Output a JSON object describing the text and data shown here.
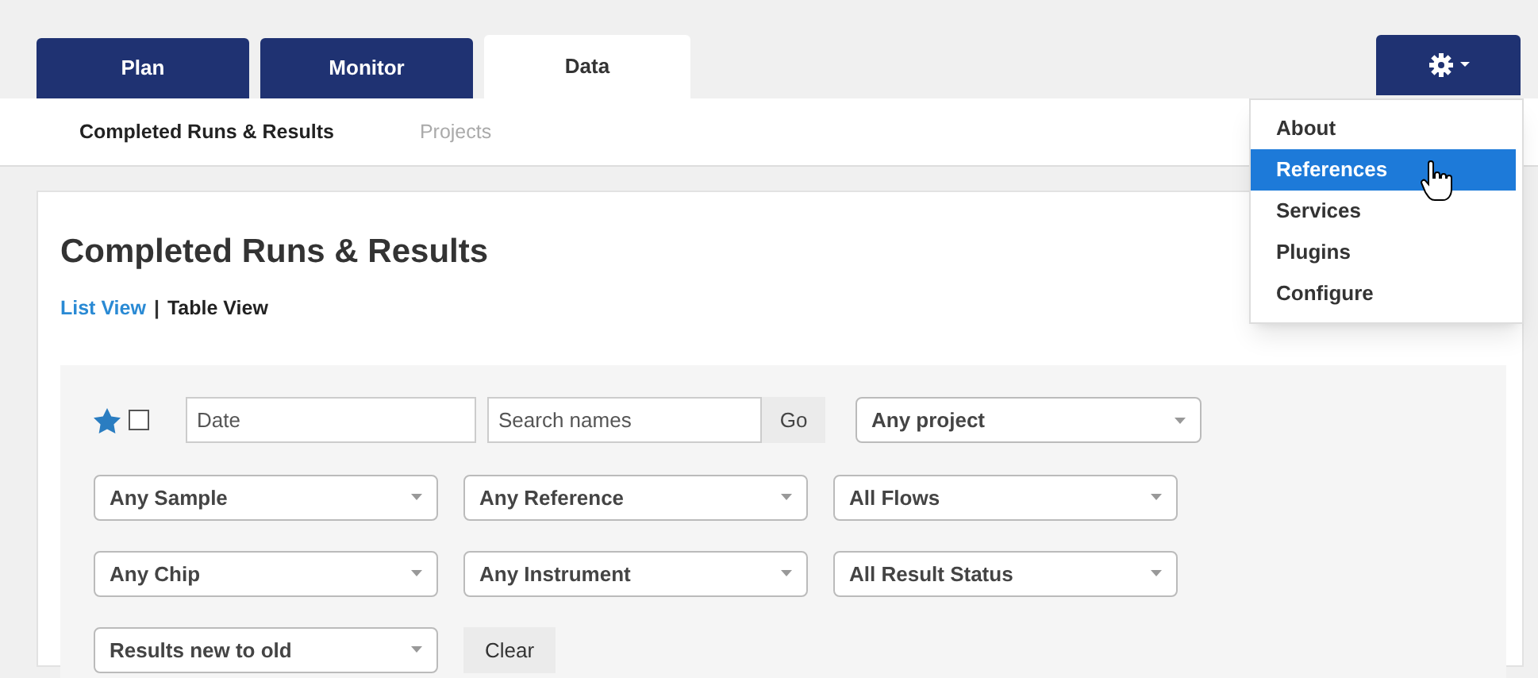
{
  "tabs": [
    {
      "label": "Plan",
      "selected": false
    },
    {
      "label": "Monitor",
      "selected": false
    },
    {
      "label": "Data",
      "selected": true
    }
  ],
  "subnav": [
    {
      "label": "Completed Runs & Results",
      "selected": true
    },
    {
      "label": "Projects",
      "selected": false
    }
  ],
  "settings_menu": {
    "expanded": true,
    "items": [
      {
        "label": "About",
        "highlighted": false
      },
      {
        "label": "References",
        "highlighted": true
      },
      {
        "label": "Services",
        "highlighted": false
      },
      {
        "label": "Plugins",
        "highlighted": false
      },
      {
        "label": "Configure",
        "highlighted": false
      }
    ]
  },
  "page_title": "Completed Runs & Results",
  "views": [
    {
      "label": "List View",
      "selected": false
    },
    {
      "label": "Table View",
      "selected": true
    }
  ],
  "view_separator": "|",
  "filters": {
    "favorites_checked": false,
    "date": {
      "placeholder": "Date"
    },
    "search": {
      "placeholder": "Search names"
    },
    "go_button": "Go",
    "project_select": "Any project",
    "selects": [
      [
        "Any Sample",
        "Any Reference",
        "All Flows"
      ],
      [
        "Any Chip",
        "Any Instrument",
        "All Result Status"
      ]
    ],
    "sort_select": "Results new to old",
    "clear_button": "Clear"
  }
}
